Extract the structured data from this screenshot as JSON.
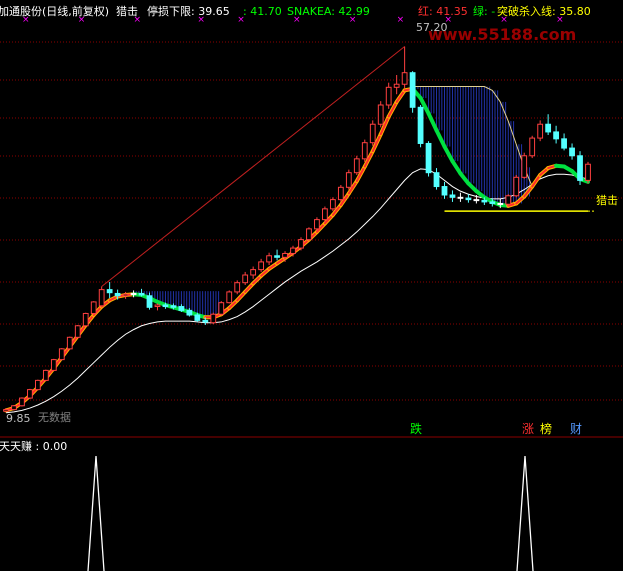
{
  "header": {
    "stock_label": "加通股份(日线,前复权)",
    "indicator_name": "猎击",
    "stop_loss_label": "停损下限: 39.65",
    "stop_loss_alt": ": 41.70",
    "snakea_label": "SNAKEA: 42.99",
    "red_label": "红: 41.35",
    "green_label": "绿: -",
    "breakout_label": "突破杀入线: 35.80"
  },
  "annotations": {
    "high_price": "57.20",
    "low_price": "9.85",
    "no_data_label": "无数据",
    "hunt_label": "猎击",
    "die_label": "跌",
    "zhang_label": "涨",
    "bang_label": "榜",
    "cai_label": "财",
    "watermark": "www.55188.com"
  },
  "sub_panel": {
    "label": "天天赚 : 0.00"
  },
  "colors": {
    "background": "#000000",
    "grid": "#8B0000",
    "candle_up": "#FF4040",
    "candle_down": "#54FFFF",
    "candle_flat": "#FFFFFF",
    "ma_red": "#FF2A2A",
    "ma_orange": "#FFB000",
    "ma_green": "#00E040",
    "ma_white": "#FFFFFF",
    "trend_line": "#C02020",
    "fill_band": "#2233AA",
    "yellow": "#FFFF00",
    "header_green": "#00FF00",
    "magenta_dot": "#FF00FF"
  },
  "chart_data": {
    "type": "candlestick",
    "period": "daily",
    "ylim": [
      8,
      60
    ],
    "candles": [
      [
        1,
        9.8,
        10.2,
        9.7,
        10.0
      ],
      [
        2,
        10.0,
        10.6,
        9.9,
        10.5
      ],
      [
        3,
        10.5,
        11.6,
        10.4,
        11.5
      ],
      [
        4,
        11.5,
        12.7,
        11.4,
        12.6
      ],
      [
        5,
        12.6,
        13.9,
        12.5,
        13.8
      ],
      [
        6,
        13.8,
        15.2,
        13.7,
        15.1
      ],
      [
        7,
        15.1,
        16.6,
        15.0,
        16.5
      ],
      [
        8,
        16.5,
        18.0,
        16.4,
        17.9
      ],
      [
        9,
        17.9,
        19.5,
        17.8,
        19.4
      ],
      [
        10,
        19.4,
        21.0,
        19.3,
        20.9
      ],
      [
        11,
        20.9,
        22.6,
        20.8,
        22.5
      ],
      [
        12,
        22.5,
        24.1,
        22.3,
        24.0
      ],
      [
        13,
        23.5,
        26.0,
        23.3,
        25.6
      ],
      [
        14,
        25.6,
        26.6,
        24.5,
        25.2
      ],
      [
        15,
        25.1,
        25.6,
        24.3,
        24.8
      ],
      [
        16,
        24.8,
        25.3,
        24.4,
        25.0
      ],
      [
        17,
        25.0,
        25.5,
        24.6,
        25.1
      ],
      [
        18,
        25.1,
        25.7,
        24.7,
        24.9
      ],
      [
        19,
        24.8,
        25.2,
        23.0,
        23.3
      ],
      [
        20,
        23.4,
        23.8,
        22.9,
        23.6
      ],
      [
        21,
        23.6,
        23.9,
        23.1,
        23.4
      ],
      [
        22,
        23.5,
        23.8,
        23.0,
        23.3
      ],
      [
        23,
        23.4,
        23.7,
        22.7,
        22.9
      ],
      [
        24,
        22.9,
        23.2,
        22.1,
        22.3
      ],
      [
        25,
        22.3,
        22.6,
        21.4,
        21.6
      ],
      [
        26,
        21.6,
        22.0,
        21.0,
        21.4
      ],
      [
        27,
        21.3,
        22.6,
        21.1,
        22.4
      ],
      [
        28,
        22.4,
        24.1,
        22.2,
        23.9
      ],
      [
        29,
        23.9,
        25.5,
        23.8,
        25.3
      ],
      [
        30,
        25.3,
        26.8,
        25.0,
        26.5
      ],
      [
        31,
        26.5,
        27.9,
        26.2,
        27.5
      ],
      [
        32,
        27.5,
        28.6,
        27.0,
        28.2
      ],
      [
        33,
        28.2,
        29.6,
        27.9,
        29.2
      ],
      [
        34,
        29.2,
        30.4,
        28.8,
        30.0
      ],
      [
        35,
        30.0,
        30.8,
        29.4,
        29.8
      ],
      [
        36,
        29.8,
        30.6,
        29.2,
        30.3
      ],
      [
        37,
        30.3,
        31.3,
        29.9,
        31.0
      ],
      [
        38,
        31.0,
        32.4,
        30.7,
        32.1
      ],
      [
        39,
        32.1,
        33.7,
        31.9,
        33.5
      ],
      [
        40,
        33.5,
        35.0,
        33.2,
        34.7
      ],
      [
        41,
        34.7,
        36.4,
        34.4,
        36.1
      ],
      [
        42,
        36.1,
        37.6,
        35.8,
        37.3
      ],
      [
        43,
        37.3,
        39.2,
        37.0,
        38.9
      ],
      [
        44,
        38.9,
        41.2,
        38.6,
        40.8
      ],
      [
        45,
        40.8,
        43.0,
        40.5,
        42.6
      ],
      [
        46,
        42.6,
        45.1,
        42.2,
        44.7
      ],
      [
        47,
        44.7,
        47.6,
        44.3,
        47.1
      ],
      [
        48,
        47.1,
        50.1,
        46.7,
        49.6
      ],
      [
        49,
        49.6,
        52.5,
        49.1,
        51.9
      ],
      [
        50,
        51.9,
        53.5,
        51.0,
        52.3
      ],
      [
        51,
        52.3,
        57.2,
        51.8,
        53.8
      ],
      [
        52,
        53.8,
        54.0,
        48.6,
        49.3
      ],
      [
        53,
        49.3,
        49.6,
        44.1,
        44.6
      ],
      [
        54,
        44.6,
        44.9,
        40.3,
        40.8
      ],
      [
        55,
        40.8,
        41.4,
        38.6,
        39.0
      ],
      [
        56,
        39.0,
        39.6,
        37.4,
        37.9
      ],
      [
        57,
        37.9,
        38.5,
        37.0,
        37.6
      ],
      [
        58,
        37.6,
        38.2,
        37.0,
        37.5
      ],
      [
        59,
        37.5,
        38.0,
        36.9,
        37.3
      ],
      [
        60,
        37.3,
        37.9,
        36.8,
        37.2
      ],
      [
        61,
        37.2,
        37.6,
        36.6,
        37.0
      ],
      [
        62,
        37.0,
        37.5,
        36.4,
        36.8
      ],
      [
        63,
        36.8,
        37.4,
        36.2,
        36.7
      ],
      [
        64,
        36.7,
        38.0,
        36.4,
        37.8
      ],
      [
        65,
        37.8,
        40.5,
        37.6,
        40.2
      ],
      [
        66,
        40.2,
        43.4,
        40.0,
        43.0
      ],
      [
        67,
        43.0,
        45.6,
        42.7,
        45.3
      ],
      [
        68,
        45.3,
        47.6,
        44.9,
        47.1
      ],
      [
        69,
        47.1,
        48.4,
        45.7,
        46.1
      ],
      [
        70,
        46.1,
        46.9,
        44.6,
        45.2
      ],
      [
        71,
        45.2,
        45.9,
        43.7,
        44.0
      ],
      [
        72,
        44.0,
        44.6,
        42.5,
        43.0
      ],
      [
        73,
        43.0,
        43.6,
        39.2,
        39.8
      ],
      [
        74,
        39.8,
        42.2,
        39.4,
        41.9
      ]
    ],
    "ma_fast": [
      9.9,
      10.2,
      10.9,
      11.8,
      12.9,
      14.1,
      15.4,
      16.8,
      18.2,
      19.6,
      21.0,
      22.3,
      23.4,
      24.2,
      24.7,
      24.9,
      25.0,
      24.9,
      24.5,
      24.0,
      23.6,
      23.3,
      23.0,
      22.7,
      22.3,
      22.0,
      22.0,
      22.4,
      23.2,
      24.2,
      25.3,
      26.4,
      27.4,
      28.3,
      29.0,
      29.7,
      30.4,
      31.2,
      32.1,
      33.1,
      34.2,
      35.3,
      36.6,
      38.1,
      39.7,
      41.6,
      43.6,
      45.8,
      48.1,
      50.0,
      51.5,
      51.7,
      50.5,
      48.5,
      46.3,
      44.2,
      42.3,
      40.7,
      39.4,
      38.4,
      37.6,
      37.0,
      36.6,
      36.5,
      36.8,
      37.7,
      39.0,
      40.5,
      41.4,
      41.7,
      41.6,
      41.0,
      40.0,
      39.6
    ],
    "ma_white": [
      9.6,
      9.7,
      9.9,
      10.2,
      10.6,
      11.1,
      11.7,
      12.4,
      13.2,
      14.1,
      15.1,
      16.1,
      17.1,
      18.1,
      19.0,
      19.8,
      20.4,
      20.9,
      21.2,
      21.4,
      21.5,
      21.5,
      21.5,
      21.5,
      21.4,
      21.3,
      21.3,
      21.4,
      21.7,
      22.1,
      22.7,
      23.4,
      24.2,
      25.0,
      25.8,
      26.6,
      27.3,
      28.0,
      28.6,
      29.2,
      29.9,
      30.6,
      31.4,
      32.2,
      33.1,
      34.1,
      35.1,
      36.2,
      37.4,
      38.6,
      39.8,
      40.8,
      41.3,
      41.2,
      40.6,
      39.8,
      39.0,
      38.4,
      38.0,
      37.7,
      37.5,
      37.4,
      37.4,
      37.6,
      38.0,
      38.6,
      39.3,
      40.0,
      40.4,
      40.6,
      40.6,
      40.5,
      40.2,
      40.0
    ],
    "upper_band_top": [
      52.0,
      52.0,
      52.0,
      52.0,
      52.0,
      52.0,
      52.0,
      52.0,
      52.0,
      52.0,
      51.5,
      50.0,
      47.5,
      44.5,
      41.5,
      39.0
    ],
    "trend_line": {
      "from": [
        13,
        26.0
      ],
      "to": [
        51,
        57.2
      ]
    },
    "hunt_line_value": 35.8
  },
  "sub_chart_data": {
    "type": "line",
    "label": "天天赚",
    "ylim": [
      0,
      1
    ],
    "peaks": [
      {
        "x": 12,
        "value": 1
      },
      {
        "x": 67,
        "value": 1
      }
    ]
  }
}
